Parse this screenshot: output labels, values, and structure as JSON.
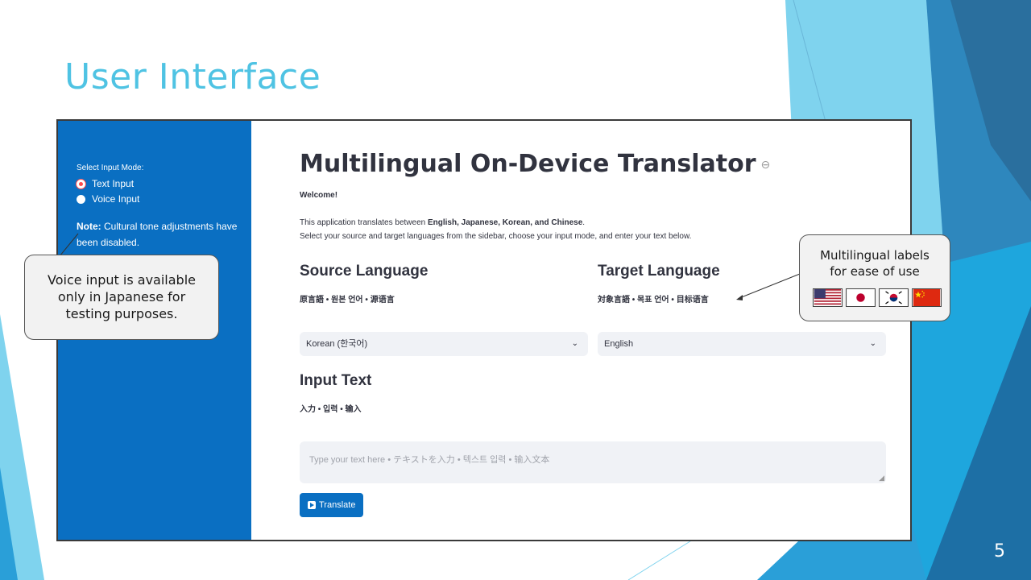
{
  "slide": {
    "title": "User Interface",
    "page_number": "5"
  },
  "sidebar": {
    "mode_label": "Select Input Mode:",
    "modes": [
      {
        "label": "Text Input",
        "selected": true
      },
      {
        "label": "Voice Input",
        "selected": false
      }
    ],
    "note_label": "Note:",
    "note_text": " Cultural tone adjustments have been disabled."
  },
  "main": {
    "title": "Multilingual On-Device Translator",
    "welcome": "Welcome!",
    "desc_part1": "This application translates between ",
    "desc_languages": "English, Japanese, Korean, and Chinese",
    "desc_part2": ".",
    "desc_line2": "Select your source and target languages from the sidebar, choose your input mode, and enter your text below.",
    "source": {
      "heading": "Source Language",
      "subheading": "原言語 • 원본 언어 • 源语言",
      "selected": "Korean (한국어)"
    },
    "target": {
      "heading": "Target Language",
      "subheading": "対象言語 • 목표 언어 • 目标语言",
      "selected": "English"
    },
    "input": {
      "heading": "Input Text",
      "subheading": "入力 • 입력 • 输入",
      "placeholder": "Type your text here • テキストを入力 • 텍스트 입력 • 输入文本"
    },
    "translate_label": "Translate"
  },
  "callouts": {
    "voice": [
      "Voice input is available",
      "only in Japanese for",
      "testing purposes."
    ],
    "labels": [
      "Multilingual labels",
      "for ease of use"
    ]
  },
  "icons": {
    "link": "link-icon",
    "chevron": "chevron-down-icon",
    "play": "play-icon",
    "flags": [
      "us-flag-icon",
      "japan-flag-icon",
      "korea-flag-icon",
      "china-flag-icon"
    ]
  },
  "colors": {
    "slide_title": "#4fc3e3",
    "sidebar": "#0a6fc2",
    "radio_selected": "#ff4b4b",
    "button": "#0a6fc2",
    "deco_light": "#7fd3ee",
    "deco_mid": "#2a9fd8",
    "deco_dark": "#1d6fa5"
  }
}
